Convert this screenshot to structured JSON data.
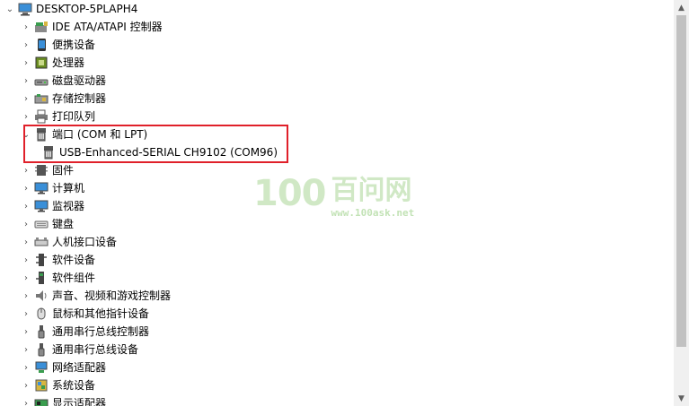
{
  "root": {
    "label": "DESKTOP-5PLAPH4",
    "icon": "computer-icon",
    "expanded": true
  },
  "items": [
    {
      "label": "IDE ATA/ATAPI 控制器",
      "icon": "ide-controller-icon",
      "name": "ide-controller"
    },
    {
      "label": "便携设备",
      "icon": "portable-device-icon",
      "name": "portable-devices"
    },
    {
      "label": "处理器",
      "icon": "processor-icon",
      "name": "processors"
    },
    {
      "label": "磁盘驱动器",
      "icon": "disk-drive-icon",
      "name": "disk-drives"
    },
    {
      "label": "存储控制器",
      "icon": "storage-controller-icon",
      "name": "storage-controllers"
    },
    {
      "label": "打印队列",
      "icon": "printer-icon",
      "name": "print-queues"
    },
    {
      "label": "端口 (COM 和 LPT)",
      "icon": "port-icon",
      "name": "ports",
      "expanded": true,
      "children": [
        {
          "label": "USB-Enhanced-SERIAL CH9102 (COM96)",
          "icon": "port-icon"
        }
      ]
    },
    {
      "label": "固件",
      "icon": "firmware-icon",
      "name": "firmware"
    },
    {
      "label": "计算机",
      "icon": "monitor-icon",
      "name": "computer"
    },
    {
      "label": "监视器",
      "icon": "monitor-icon",
      "name": "monitors"
    },
    {
      "label": "键盘",
      "icon": "keyboard-icon",
      "name": "keyboards"
    },
    {
      "label": "人机接口设备",
      "icon": "hid-icon",
      "name": "human-interface-devices"
    },
    {
      "label": "软件设备",
      "icon": "software-device-icon",
      "name": "software-devices"
    },
    {
      "label": "软件组件",
      "icon": "software-component-icon",
      "name": "software-components"
    },
    {
      "label": "声音、视频和游戏控制器",
      "icon": "speaker-icon",
      "name": "sound-video-game-controllers"
    },
    {
      "label": "鼠标和其他指针设备",
      "icon": "mouse-icon",
      "name": "mice"
    },
    {
      "label": "通用串行总线控制器",
      "icon": "usb-icon",
      "name": "usb-controllers"
    },
    {
      "label": "通用串行总线设备",
      "icon": "usb-icon",
      "name": "usb-devices"
    },
    {
      "label": "网络适配器",
      "icon": "network-adapter-icon",
      "name": "network-adapters"
    },
    {
      "label": "系统设备",
      "icon": "system-device-icon",
      "name": "system-devices"
    },
    {
      "label": "显示适配器",
      "icon": "display-adapter-icon",
      "name": "display-adapters"
    }
  ],
  "watermark": {
    "logo": "100",
    "name": "百问网",
    "url": "www.100ask.net"
  },
  "colors": {
    "highlight": "#e0202a",
    "watermark": "#78be5a",
    "scrollbar_thumb": "#c1c1c1"
  }
}
